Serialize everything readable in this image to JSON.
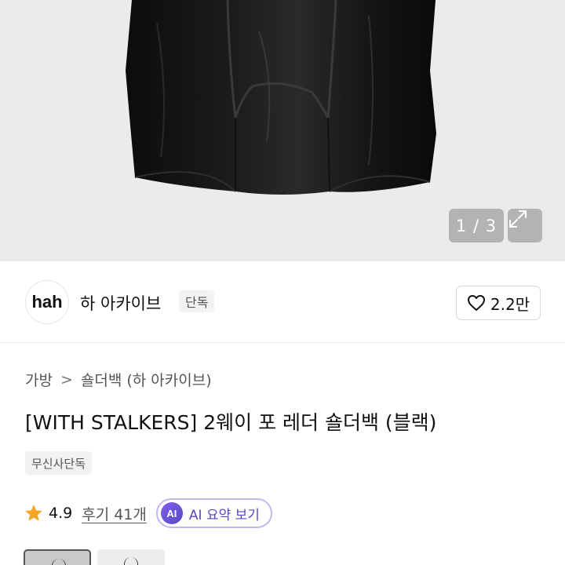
{
  "hero": {
    "image_alt": "black leather shoulder bag",
    "counter": "1 / 3",
    "expand_icon": "expand-icon"
  },
  "brand": {
    "logo_text": "hah",
    "name": "하 아카이브",
    "badge": "단독",
    "like_count": "2.2만",
    "like_icon": "heart-icon"
  },
  "breadcrumb": {
    "items": [
      "가방",
      "숄더백 (하 아카이브)"
    ],
    "separator": ">"
  },
  "product": {
    "title": "[WITH STALKERS] 2웨이 포 레더 숄더백 (블랙)",
    "tag": "무신사단독"
  },
  "rating": {
    "score": "4.9",
    "reviews_label": "후기 41개",
    "star_color": "#f5a623"
  },
  "ai_summary": {
    "icon_text": "AI",
    "label": "AI 요약 보기",
    "accent": "#5b46c8"
  },
  "thumbnails": {
    "count_visible": 2,
    "selected_index": 0
  }
}
